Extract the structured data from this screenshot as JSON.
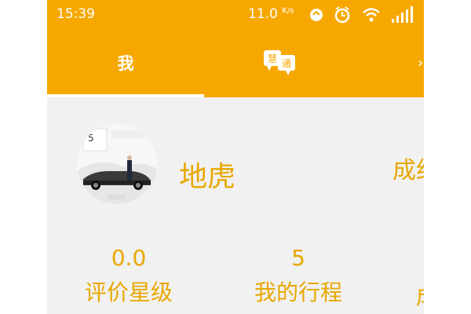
{
  "status_bar": {
    "time": "15:39",
    "net_speed": "11.0",
    "net_unit": "K/s"
  },
  "tabs": [
    {
      "label": "我",
      "selected": true
    },
    {
      "label": "",
      "icon": "chat-bubbles-icon",
      "icon_text_1": "慧",
      "icon_text_2": "通"
    }
  ],
  "profile": {
    "name": "地虎",
    "right_partial": "成约"
  },
  "stats": {
    "rating_value": "0.0",
    "rating_label": "评价星级",
    "trips_value": "5",
    "trips_label": "我的行程",
    "partial_label": "成"
  },
  "colors": {
    "accent": "#f6a800",
    "text_accent": "#e8a800",
    "background": "#f1f1f1"
  }
}
